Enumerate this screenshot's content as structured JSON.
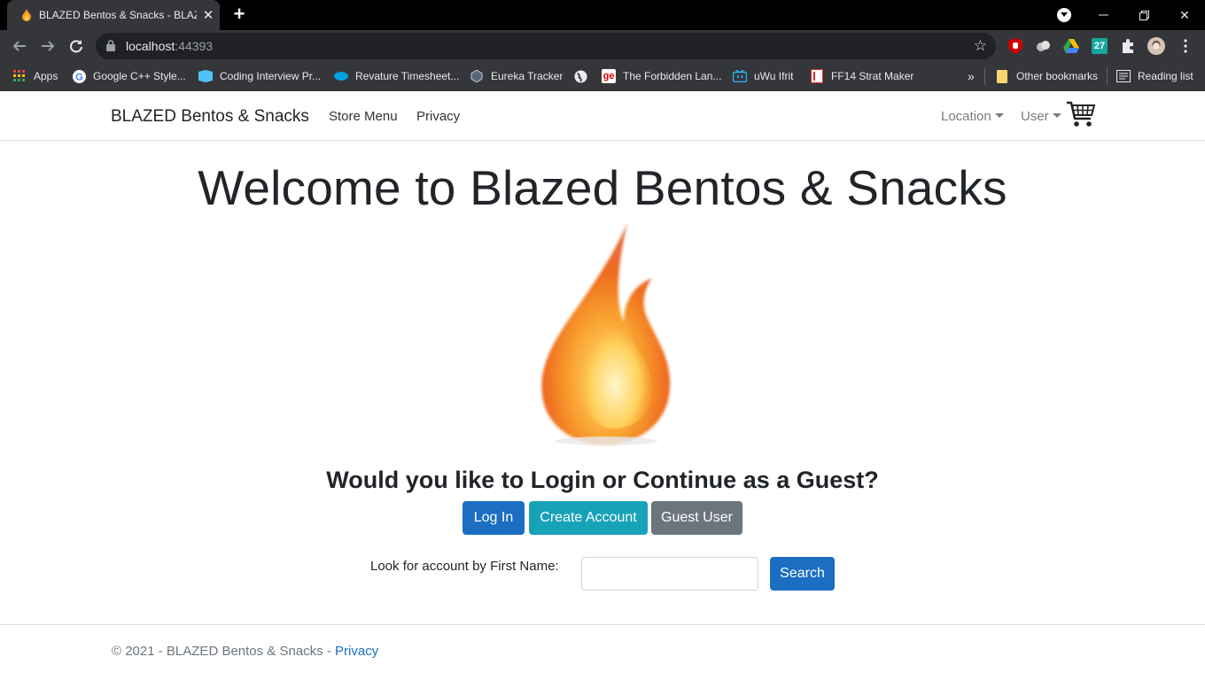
{
  "browser": {
    "tab_title": "BLAZED Bentos & Snacks - BLAZED",
    "url_host": "localhost",
    "url_port": ":44393",
    "bookmarks": [
      {
        "label": "Apps",
        "icon": "apps-grid-icon"
      },
      {
        "label": "Google C++ Style...",
        "icon": "google-icon"
      },
      {
        "label": "Coding Interview Pr...",
        "icon": "bookmark-site-icon"
      },
      {
        "label": "Revature Timesheet...",
        "icon": "salesforce-icon"
      },
      {
        "label": "Eureka Tracker",
        "icon": "eureka-icon"
      },
      {
        "label": "",
        "icon": "globe-icon"
      },
      {
        "label": "The Forbidden Lan...",
        "icon": "ge-icon"
      },
      {
        "label": "uWu Ifrit",
        "icon": "twitch-icon"
      },
      {
        "label": "FF14 Strat Maker",
        "icon": "page-icon"
      }
    ],
    "bookmarks_overflow": "»",
    "other_bookmarks": "Other bookmarks",
    "reading_list": "Reading list",
    "calendar_badge": "27"
  },
  "site": {
    "brand": "BLAZED Bentos & Snacks",
    "nav": {
      "store_menu": "Store Menu",
      "privacy": "Privacy",
      "location": "Location",
      "user": "User"
    }
  },
  "main": {
    "heading": "Welcome to Blazed Bentos & Snacks",
    "question": "Would you like to Login or Continue as a Guest?",
    "buttons": {
      "login": "Log In",
      "create": "Create Account",
      "guest": "Guest User"
    },
    "search": {
      "label": "Look for account by First Name:",
      "value": "",
      "placeholder": "",
      "button": "Search"
    }
  },
  "footer": {
    "text": "© 2021 - BLAZED Bentos & Snacks - ",
    "privacy_link": "Privacy"
  },
  "colors": {
    "primary": "#1b6ec2",
    "info": "#17a2b8",
    "secondary": "#6c757d"
  }
}
